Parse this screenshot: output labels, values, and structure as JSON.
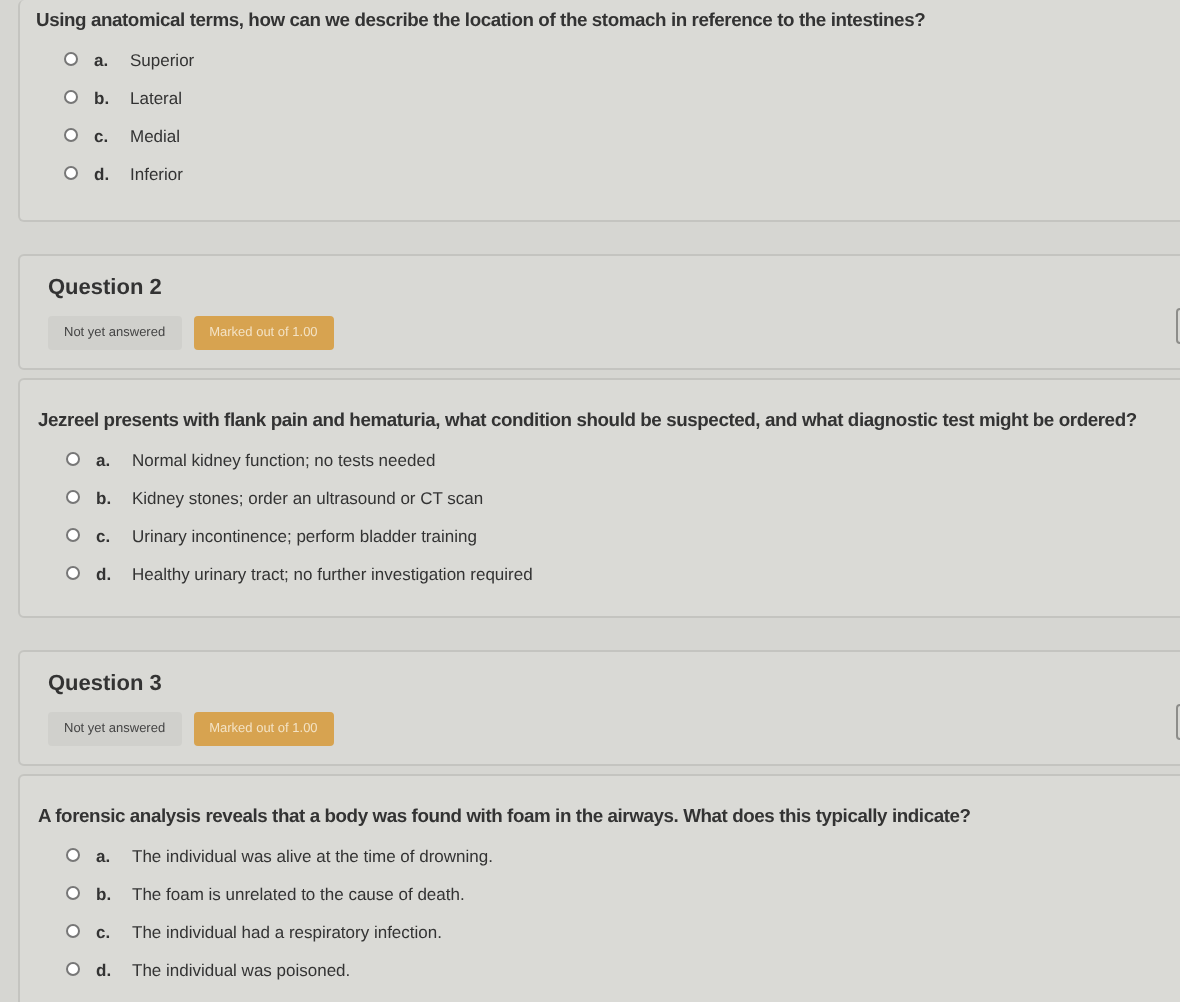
{
  "questions": [
    {
      "text": "Using anatomical terms, how can we describe the location of the stomach in reference to the intestines?",
      "options": [
        {
          "letter": "a.",
          "label": "Superior",
          "selected": false
        },
        {
          "letter": "b.",
          "label": "Lateral",
          "selected": false
        },
        {
          "letter": "c.",
          "label": "Medial",
          "selected": false
        },
        {
          "letter": "d.",
          "label": "Inferior",
          "selected": false
        }
      ]
    },
    {
      "number": "Question 2",
      "status": "Not yet answered",
      "marks": "Marked out of 1.00",
      "text": "Jezreel presents with flank pain and hematuria, what condition should be suspected, and what diagnostic test might be ordered?",
      "options": [
        {
          "letter": "a.",
          "label": "Normal kidney function; no tests needed",
          "selected": false
        },
        {
          "letter": "b.",
          "label": "Kidney stones; order an ultrasound or CT scan",
          "selected": false
        },
        {
          "letter": "c.",
          "label": "Urinary incontinence; perform bladder training",
          "selected": false
        },
        {
          "letter": "d.",
          "label": "Healthy urinary tract; no further investigation required",
          "selected": false
        }
      ]
    },
    {
      "number": "Question 3",
      "status": "Not yet answered",
      "marks": "Marked out of 1.00",
      "text": "A forensic analysis reveals that a body was found with foam in the airways. What does this typically indicate?",
      "options": [
        {
          "letter": "a.",
          "label": "The individual was alive at the time of drowning.",
          "selected": false
        },
        {
          "letter": "b.",
          "label": "The foam is unrelated to the cause of death.",
          "selected": false
        },
        {
          "letter": "c.",
          "label": "The individual had a respiratory infection.",
          "selected": false
        },
        {
          "letter": "d.",
          "label": "The individual was poisoned.",
          "selected": false
        }
      ]
    }
  ]
}
